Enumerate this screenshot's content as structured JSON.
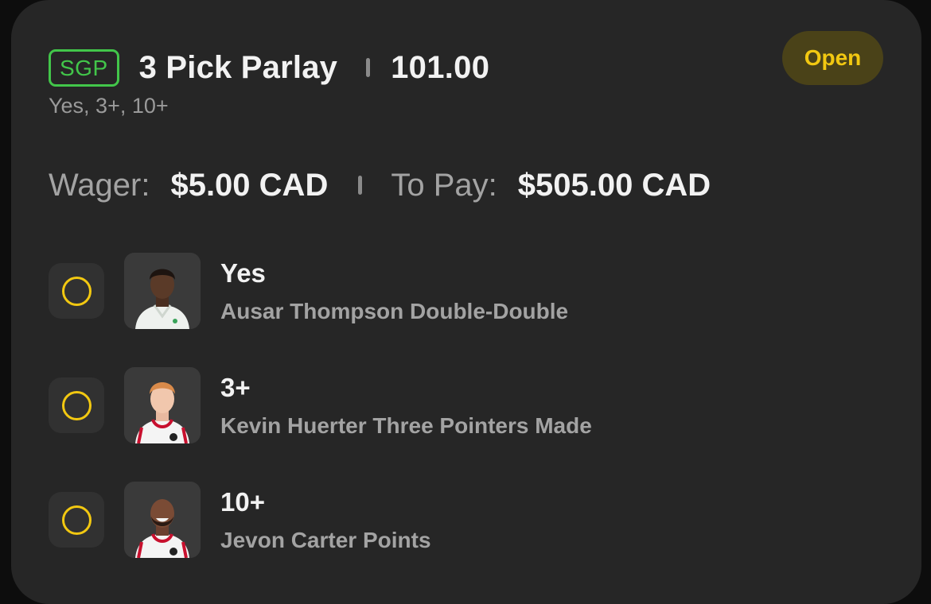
{
  "bet": {
    "badge": "SGP",
    "title": "3 Pick Parlay",
    "odds": "101.00",
    "status": "Open",
    "summary": "Yes, 3+, 10+"
  },
  "wager": {
    "wager_label": "Wager:",
    "wager_amount": "$5.00 CAD",
    "payout_label": "To Pay:",
    "payout_amount": "$505.00 CAD"
  },
  "legs": [
    {
      "pick": "Yes",
      "description": "Ausar Thompson Double-Double",
      "avatar_icon": "player-headshot-icon"
    },
    {
      "pick": "3+",
      "description": "Kevin Huerter Three Pointers Made",
      "avatar_icon": "player-headshot-icon"
    },
    {
      "pick": "10+",
      "description": "Jevon Carter Points",
      "avatar_icon": "player-headshot-icon"
    }
  ],
  "colors": {
    "accent_green": "#42c64a",
    "status_yellow": "#f2c811",
    "card_background": "#262626"
  }
}
